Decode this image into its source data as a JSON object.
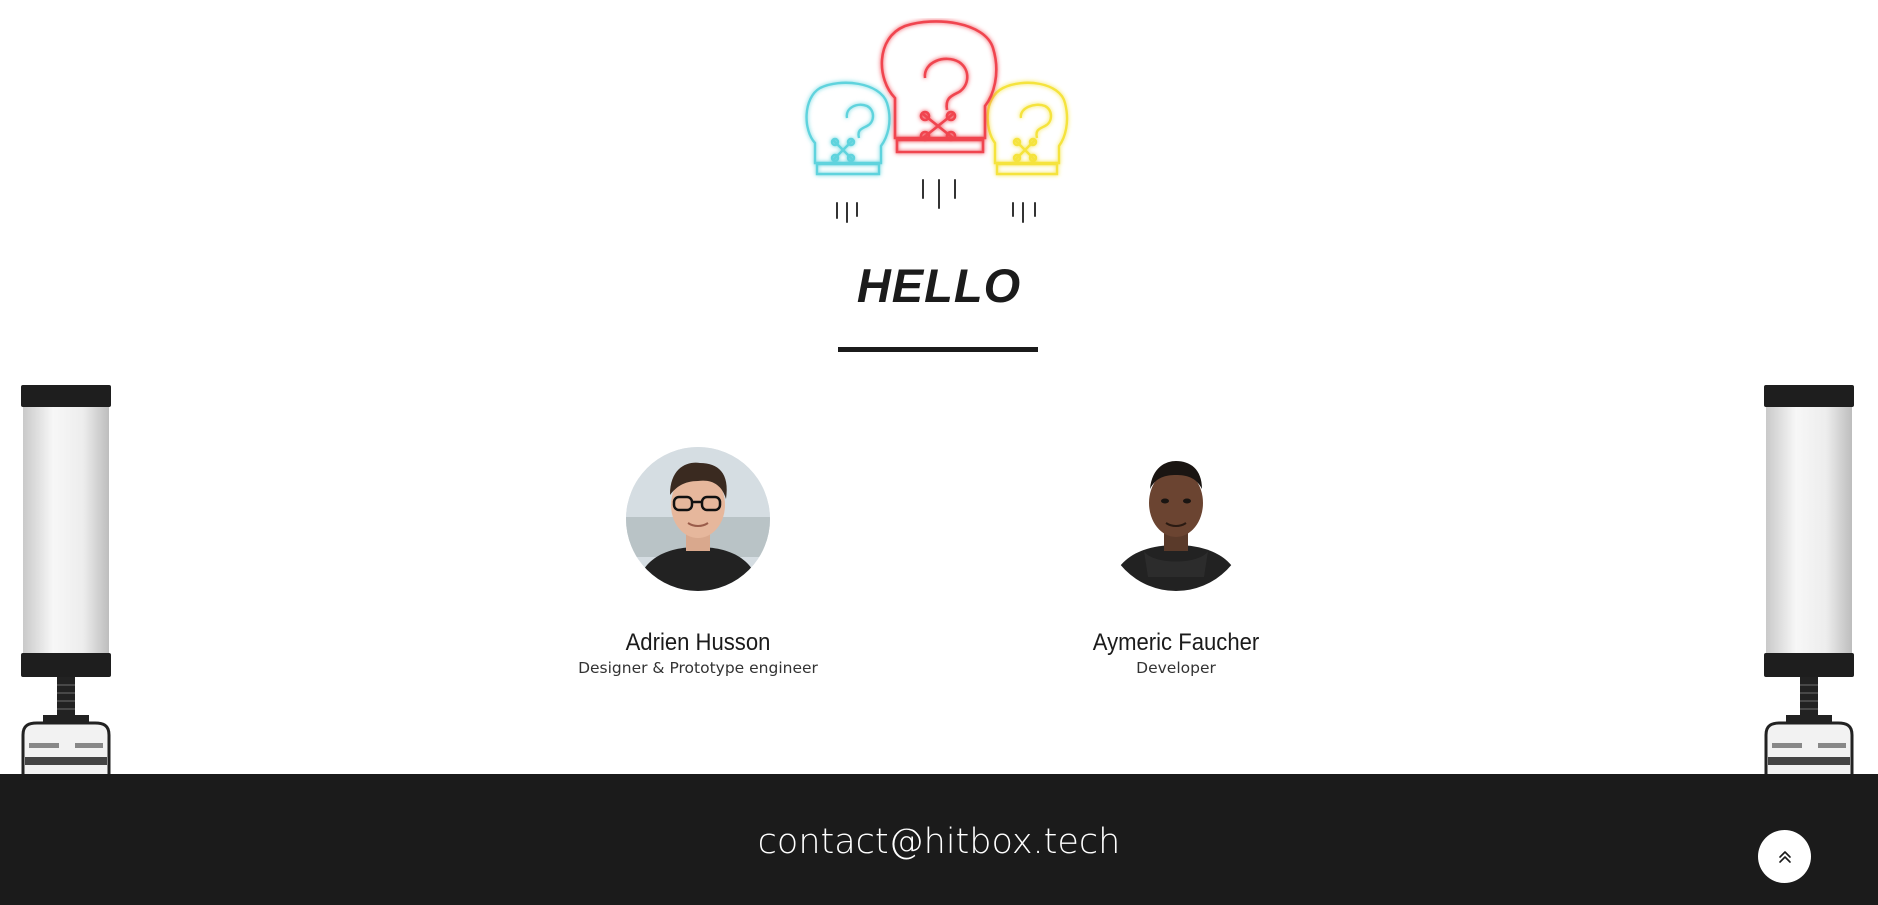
{
  "hero": {
    "logo_icon": "boxing-gloves-neon-logo",
    "glove_colors": {
      "left": "#5fd3dd",
      "center": "#f0454f",
      "right": "#f5e33c"
    },
    "title": "HELLO"
  },
  "team": {
    "members": [
      {
        "name": "Adrien Husson",
        "role": "Designer & Prototype engineer",
        "avatar_icon": "portrait-photo"
      },
      {
        "name": "Aymeric Faucher",
        "role": "Developer",
        "avatar_icon": "portrait-photo"
      }
    ]
  },
  "footer": {
    "email": "contact@hitbox.tech",
    "scroll_top_icon": "double-chevron-up-icon",
    "background": "#1b1b1b"
  }
}
